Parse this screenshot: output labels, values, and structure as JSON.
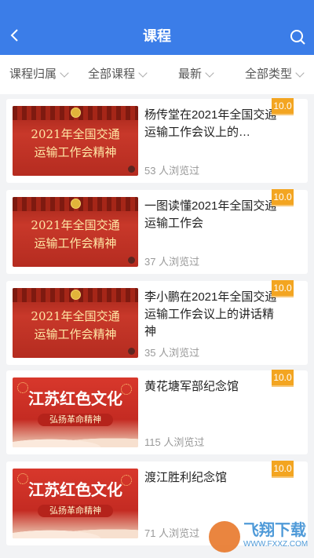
{
  "header": {
    "title": "课程",
    "back_icon": "chevron-left-icon",
    "search_icon": "search-icon"
  },
  "filters": [
    {
      "label": "课程归属"
    },
    {
      "label": "全部课程"
    },
    {
      "label": "最新"
    },
    {
      "label": "全部类型"
    }
  ],
  "courses": [
    {
      "title": "杨传堂在2021年全国交通运输工作会议上的…",
      "views": "53 人浏览过",
      "score": "10.0",
      "thumb_line1": "2021年全国交通",
      "thumb_line2": "运输工作会精神"
    },
    {
      "title": "一图读懂2021年全国交通运输工作会",
      "views": "37 人浏览过",
      "score": "10.0",
      "thumb_line1": "2021年全国交通",
      "thumb_line2": "运输工作会精神"
    },
    {
      "title": "李小鹏在2021年全国交通运输工作会议上的讲话精神",
      "views": "35 人浏览过",
      "score": "10.0",
      "thumb_line1": "2021年全国交通",
      "thumb_line2": "运输工作会精神"
    },
    {
      "title": "黄花塘军部纪念馆",
      "views": "115 人浏览过",
      "score": "10.0",
      "thumb_line1": "江苏红色文化",
      "thumb_line2": "弘扬革命精神"
    },
    {
      "title": "渡江胜利纪念馆",
      "views": "71 人浏览过",
      "score": "10.0",
      "thumb_line1": "江苏红色文化",
      "thumb_line2": "弘扬革命精神"
    }
  ],
  "watermark": {
    "text": "飞翔下载",
    "url": "WWW.FXXZ.COM"
  },
  "colors": {
    "header": "#3b7de8",
    "score_badge": "#f3a521"
  }
}
